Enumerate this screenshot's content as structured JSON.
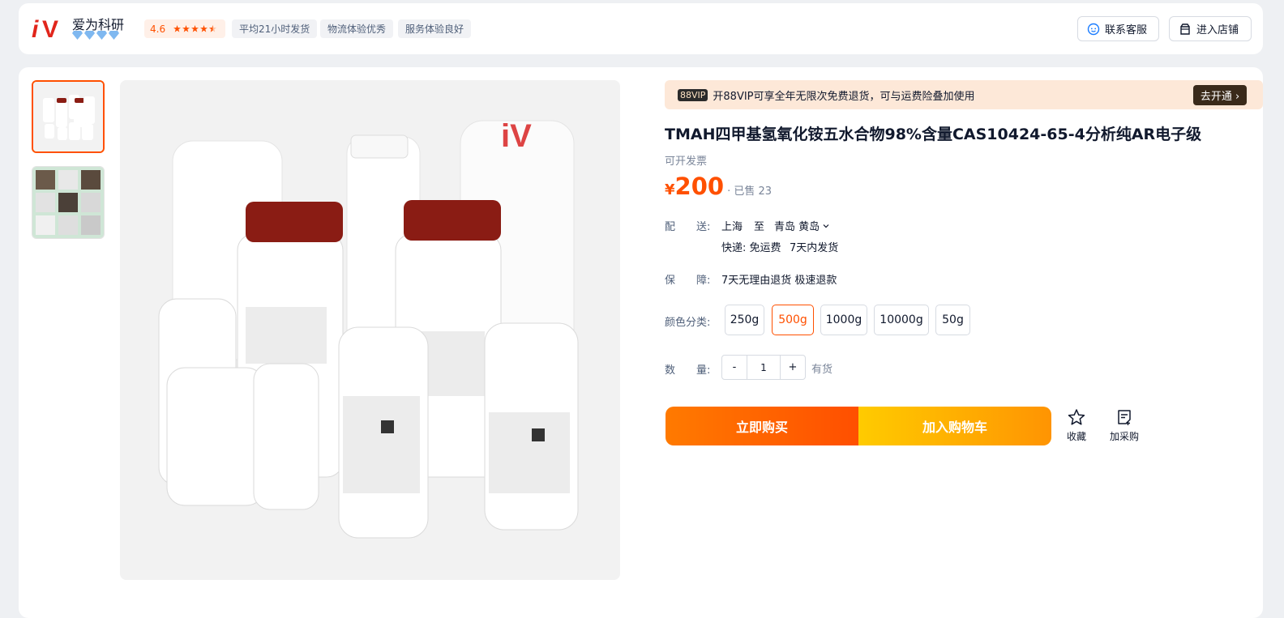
{
  "shop": {
    "name": "爱为科研",
    "logo_text": "iV",
    "rating": "4.6",
    "tags": [
      "平均21小时发货",
      "物流体验优秀",
      "服务体验良好"
    ],
    "contact_label": "联系客服",
    "enter_store_label": "进入店铺"
  },
  "vip": {
    "tag": "88VIP",
    "text": "开88VIP可享全年无限次免费退货，可与运费险叠加使用",
    "button": "去开通 ›"
  },
  "product": {
    "title": "TMAH四甲基氢氧化铵五水合物98%含量CAS10424-65-4分析纯AR电子级",
    "invoice": "可开发票",
    "currency": "¥",
    "price": "200",
    "sold": "· 已售 23",
    "image_watermark": "iV爱为"
  },
  "delivery": {
    "label": "配　　送:",
    "from": "上海",
    "to_word": "至",
    "dest": "青岛 黄岛",
    "express": "快递: 免运费",
    "ship_time": "7天内发货"
  },
  "guarantee": {
    "label": "保　　障:",
    "value": "7天无理由退货 极速退款"
  },
  "sku": {
    "label": "颜色分类:",
    "options": [
      "250g",
      "500g",
      "1000g",
      "10000g",
      "50g"
    ],
    "selected": "500g"
  },
  "quantity": {
    "label": "数　　量:",
    "minus": "-",
    "value": "1",
    "plus": "+",
    "stock": "有货"
  },
  "actions": {
    "buy_now": "立即购买",
    "add_cart": "加入购物车",
    "favorite": "收藏",
    "purchase_list": "加采购"
  },
  "colors": {
    "accent": "#ff5000",
    "brand_red": "#e1251b"
  }
}
